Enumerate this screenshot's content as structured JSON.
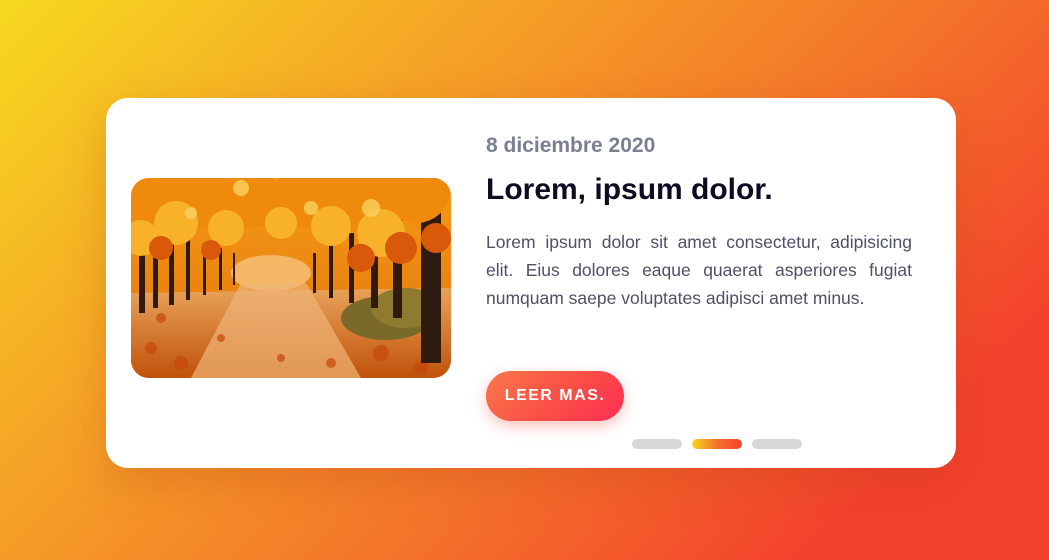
{
  "slide": {
    "date": "8 diciembre 2020",
    "title": "Lorem, ipsum dolor.",
    "text": "Lorem ipsum dolor sit amet consectetur, adipisicing elit. Eius dolores eaque quaerat asperiores fugiat numquam saepe voluptates adipisci amet minus.",
    "button_label": "LEER MAS.",
    "image": "autumn-tree-alley"
  },
  "pagination": {
    "total": 3,
    "active_index": 1
  },
  "colors": {
    "accent_start": "#f9784a",
    "accent_end": "#fc2f54",
    "dot_inactive": "#d8d8d8",
    "title": "#0d0c22",
    "date": "#7b7f92",
    "body_text": "#4e5066"
  }
}
